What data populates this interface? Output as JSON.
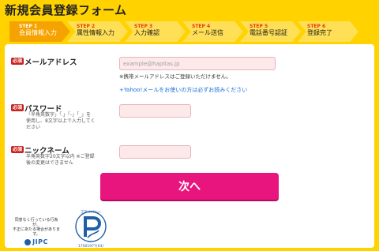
{
  "header": {
    "title": "新規会員登録フォーム"
  },
  "steps": [
    {
      "num": "STEP 1",
      "label": "会員情報入力",
      "active": true
    },
    {
      "num": "STEP 2",
      "label": "属性情報入力",
      "active": false
    },
    {
      "num": "STEP 3",
      "label": "入力確認",
      "active": false
    },
    {
      "num": "STEP 4",
      "label": "メール送信",
      "active": false
    },
    {
      "num": "STEP 5",
      "label": "電話番号認証",
      "active": false
    },
    {
      "num": "STEP 6",
      "label": "登録完了",
      "active": false
    }
  ],
  "form": {
    "required_badge": "必須",
    "email": {
      "label": "メールアドレス",
      "placeholder": "example@hapitas.jp",
      "hint": "※携帯メールアドレスはご登録いただけません。",
      "yahoo_link": "+Yahoo!メールをお使いの方は必ずお読みください"
    },
    "password": {
      "label": "パスワード",
      "note_lines": [
        "「半角英数字」「.」「-」「_」を",
        "使用し、8文字以上で入力してく",
        "ださい"
      ],
      "value": ""
    },
    "nickname": {
      "label": "ニックネーム",
      "note_lines": [
        "半角英数字20文字以内 ※ご登録",
        "後の変更はできません"
      ],
      "value": ""
    },
    "submit_label": "次へ"
  },
  "footer": {
    "jipc_text_lines": [
      "同意なく行っている行為が、",
      "不正にあたる場合があります。"
    ],
    "jipc_logo": "JIPC",
    "pmark_top": "プライバシー",
    "pmark_number": "17001977(03)"
  },
  "colors": {
    "background": "#ffd200",
    "active_step": "#f5a300",
    "required": "#c8211f",
    "submit": "#e8157f",
    "link": "#1a6fd8"
  }
}
